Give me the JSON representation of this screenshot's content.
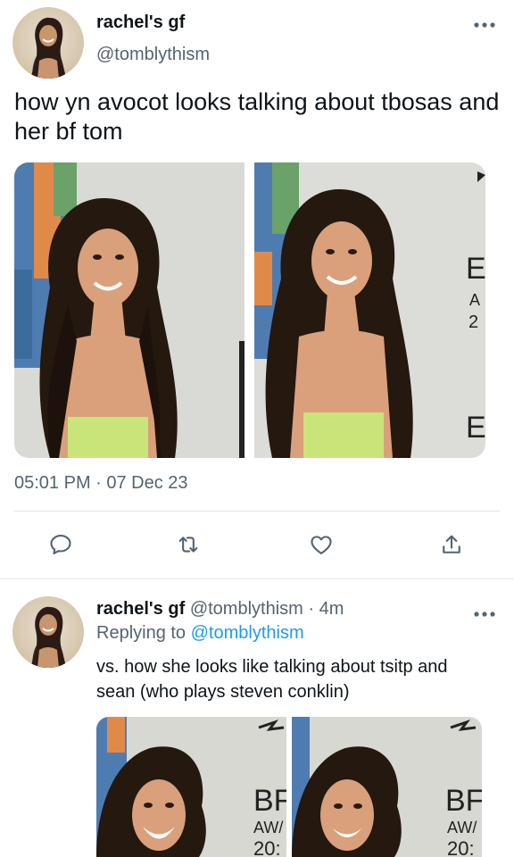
{
  "main_tweet": {
    "author_name": "rachel's gf",
    "author_handle": "@tomblythism",
    "more_icon": "more-horizontal-icon",
    "text": "how yn avocot looks talking about tbosas and her bf tom",
    "timestamp": "05:01 PM · 07 Dec 23",
    "actions": [
      "reply-icon",
      "retweet-icon",
      "like-icon",
      "share-icon"
    ]
  },
  "reply_tweet": {
    "author_name": "rachel's gf",
    "author_handle": "@tomblythism",
    "separator": " · ",
    "age": "4m",
    "replying_prefix": "Replying to ",
    "replying_to": "@tomblythism",
    "text": "vs. how she looks like talking about tsitp and sean (who plays steven conklin)"
  },
  "media_overlay_text": {
    "img2_letters": [
      "E",
      "A",
      "2",
      "E"
    ],
    "img3_letters": [
      "BF",
      "AW/",
      "20:"
    ],
    "img4_letters": [
      "BF",
      "AW/",
      "20:"
    ]
  },
  "colors": {
    "text_primary": "#0f1419",
    "text_secondary": "#536471",
    "link": "#1d9bf0",
    "divider": "#e1e6ea"
  }
}
